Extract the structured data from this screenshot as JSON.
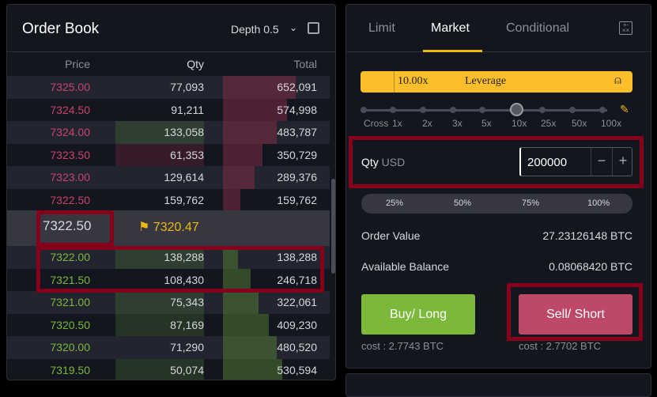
{
  "order_book": {
    "title": "Order Book",
    "depth_label": "Depth 0.5",
    "columns": {
      "price": "Price",
      "qty": "Qty",
      "total": "Total"
    },
    "asks": [
      {
        "price": "7325.00",
        "qty": "77,093",
        "total": "652,091",
        "depth": 1.0,
        "qty_bg": ""
      },
      {
        "price": "7324.50",
        "qty": "91,211",
        "total": "574,998",
        "depth": 0.88,
        "qty_bg": ""
      },
      {
        "price": "7324.00",
        "qty": "133,058",
        "total": "483,787",
        "depth": 0.74,
        "qty_bg": "green"
      },
      {
        "price": "7323.50",
        "qty": "61,353",
        "total": "350,729",
        "depth": 0.54,
        "qty_bg": "red"
      },
      {
        "price": "7323.00",
        "qty": "129,614",
        "total": "289,376",
        "depth": 0.44,
        "qty_bg": ""
      },
      {
        "price": "7322.50",
        "qty": "159,762",
        "total": "159,762",
        "depth": 0.24,
        "qty_bg": ""
      }
    ],
    "last_price": "7322.50",
    "mark_price": "7320.47",
    "bids": [
      {
        "price": "7322.00",
        "qty": "138,288",
        "total": "138,288",
        "depth": 0.21,
        "qty_bg": "green"
      },
      {
        "price": "7321.50",
        "qty": "108,430",
        "total": "246,718",
        "depth": 0.38,
        "qty_bg": ""
      },
      {
        "price": "7321.00",
        "qty": "75,343",
        "total": "322,061",
        "depth": 0.49,
        "qty_bg": "green"
      },
      {
        "price": "7320.50",
        "qty": "87,169",
        "total": "409,230",
        "depth": 0.63,
        "qty_bg": "green"
      },
      {
        "price": "7320.00",
        "qty": "71,290",
        "total": "480,520",
        "depth": 0.74,
        "qty_bg": ""
      },
      {
        "price": "7319.50",
        "qty": "50,074",
        "total": "530,594",
        "depth": 0.81,
        "qty_bg": "green"
      }
    ]
  },
  "trade": {
    "tabs": [
      "Limit",
      "Market",
      "Conditional"
    ],
    "active_tab": "Market",
    "leverage_value": "10.00x",
    "leverage_label": "Leverage",
    "leverage_steps": [
      "Cross",
      "1x",
      "2x",
      "3x",
      "5x",
      "10x",
      "25x",
      "50x",
      "100x"
    ],
    "leverage_selected": "10x",
    "qty_label": "Qty",
    "qty_unit": "USD",
    "qty_value": "200000",
    "minus": "−",
    "plus": "+",
    "percents": [
      "25%",
      "50%",
      "75%",
      "100%"
    ],
    "order_value_label": "Order Value",
    "order_value": "27.23126148 BTC",
    "balance_label": "Available Balance",
    "balance": "0.08068420 BTC",
    "buy_label": "Buy/ Long",
    "sell_label": "Sell/ Short",
    "buy_cost": "cost : 2.7743 BTC",
    "sell_cost": "cost : 2.7702 BTC"
  },
  "colors": {
    "ask": "#c9436a",
    "bid": "#7cb83a",
    "accent": "#fbbf2c",
    "buy": "#7cb83a",
    "sell": "#bd4868"
  }
}
